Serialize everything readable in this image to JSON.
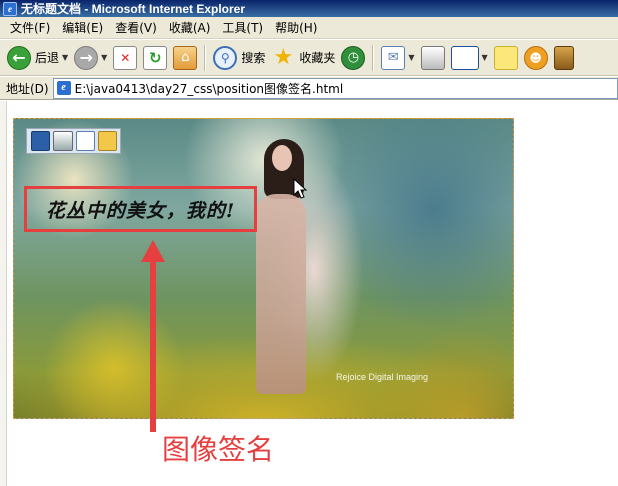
{
  "window": {
    "title": "无标题文档 - Microsoft Internet Explorer"
  },
  "menu": [
    "文件(F)",
    "编辑(E)",
    "查看(V)",
    "收藏(A)",
    "工具(T)",
    "帮助(H)"
  ],
  "toolbar": {
    "back_label": "后退",
    "search_label": "搜索",
    "favorites_label": "收藏夹"
  },
  "address": {
    "label": "地址(D)",
    "url": "E:\\java0413\\day27_css\\position图像签名.html"
  },
  "page": {
    "caption": "花丛中的美女，我的!",
    "watermark": "Rejoice Digital Imaging"
  },
  "annotation": {
    "label": "图像签名",
    "color": "#e53f3f"
  }
}
